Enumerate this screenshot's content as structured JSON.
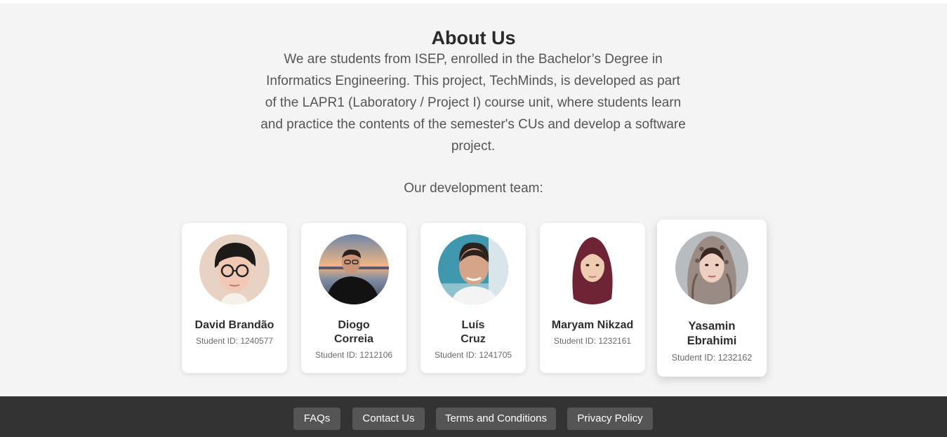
{
  "about": {
    "title": "About Us",
    "description": "We are students from ISEP, enrolled in the Bachelor’s Degree in Informatics Engineering. This project, TechMinds, is developed as part of the LAPR1 (Laboratory / Project I) course unit, where students learn and practice the contents of the semester's CUs and develop a software project.",
    "team_heading": "Our development team:"
  },
  "team": [
    {
      "name": "David Brandão",
      "student_id": "Student ID: 1240577",
      "avatar_bg": "#e8cfc0"
    },
    {
      "name": "Diogo Correia",
      "student_id": "Student ID: 1212106",
      "avatar_bg": "#d9a06a"
    },
    {
      "name": "Luís Cruz",
      "student_id": "Student ID: 1241705",
      "avatar_bg": "#4aa3b5"
    },
    {
      "name": "Maryam Nikzad",
      "student_id": "Student ID: 1232161",
      "avatar_bg": "#ffffff"
    },
    {
      "name": "Yasamin Ebrahimi",
      "student_id": "Student ID: 1232162",
      "avatar_bg": "#b9bcbf"
    }
  ],
  "footer": {
    "links": [
      "FAQs",
      "Contact Us",
      "Terms and Conditions",
      "Privacy Policy"
    ]
  },
  "colors": {
    "section_bg": "#f4f4f4",
    "footer_bg": "#333333",
    "footer_button_bg": "#555555"
  }
}
